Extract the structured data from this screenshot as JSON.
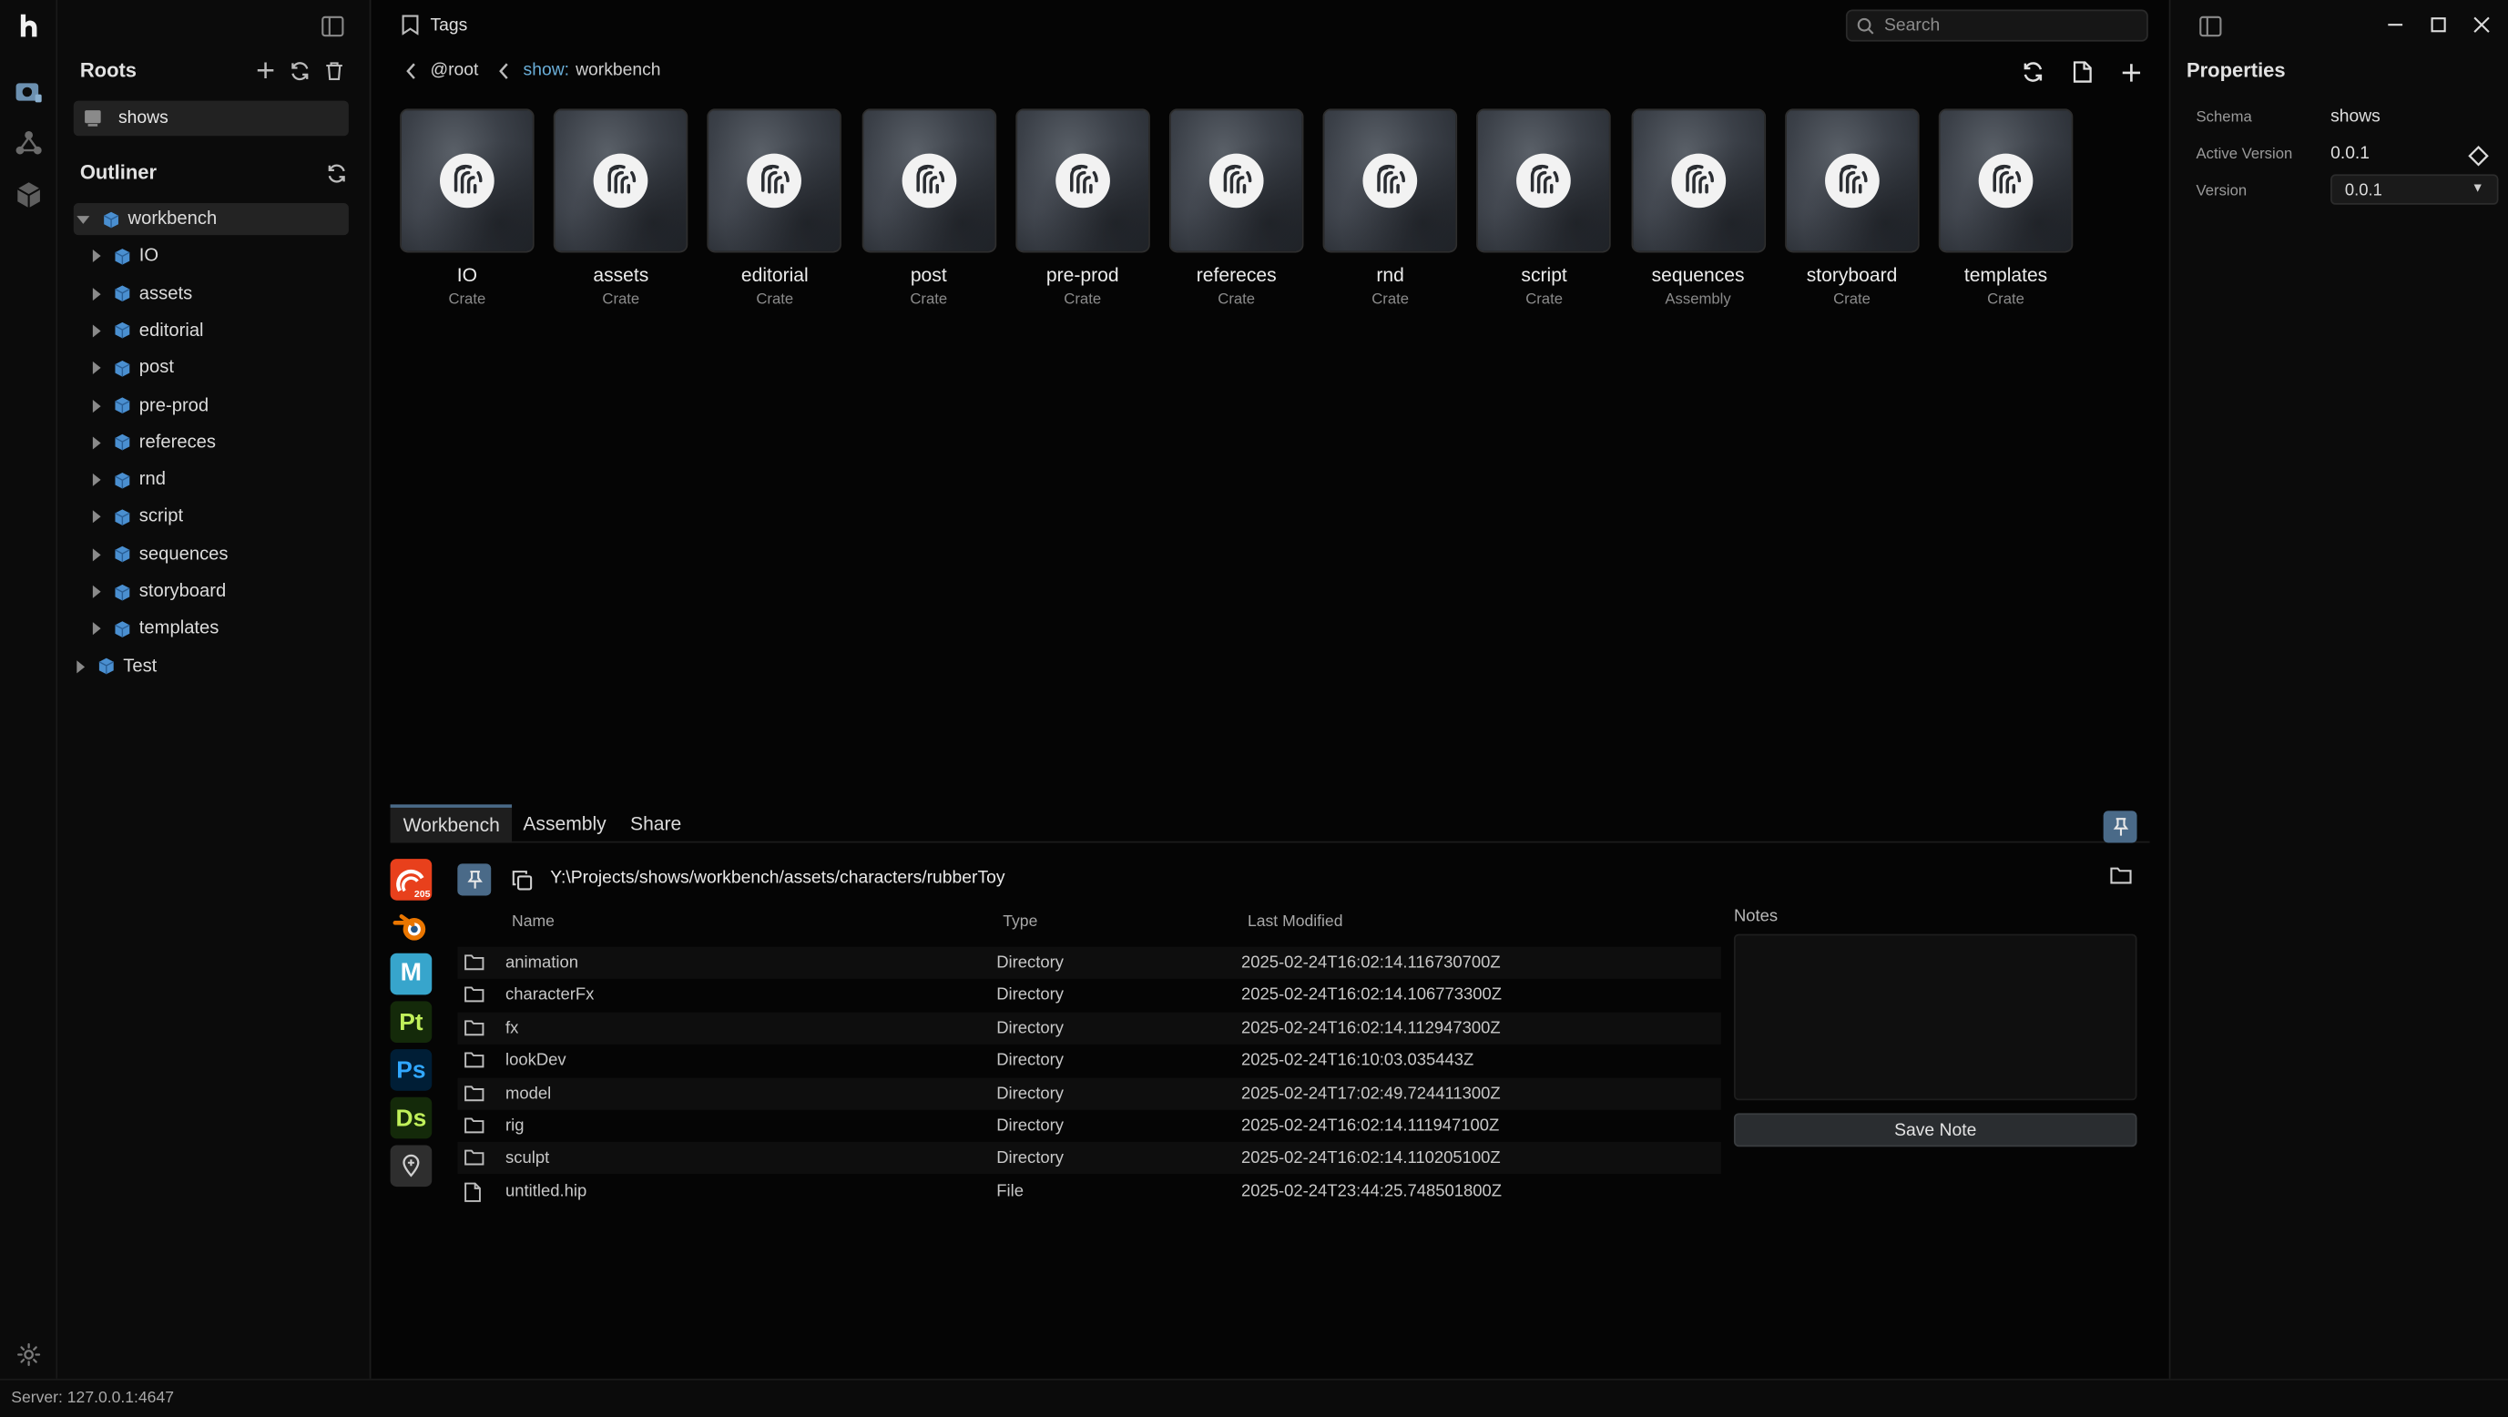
{
  "roots": {
    "title": "Roots",
    "items": [
      {
        "label": "shows"
      }
    ]
  },
  "outliner": {
    "title": "Outliner",
    "tree": [
      {
        "label": "workbench",
        "expanded": true,
        "selected": true,
        "children": [
          {
            "label": "IO"
          },
          {
            "label": "assets"
          },
          {
            "label": "editorial"
          },
          {
            "label": "post"
          },
          {
            "label": "pre-prod"
          },
          {
            "label": "refereces"
          },
          {
            "label": "rnd"
          },
          {
            "label": "script"
          },
          {
            "label": "sequences"
          },
          {
            "label": "storyboard"
          },
          {
            "label": "templates"
          }
        ]
      },
      {
        "label": "Test",
        "expanded": false
      }
    ]
  },
  "header": {
    "tags_label": "Tags",
    "search_placeholder": "Search"
  },
  "breadcrumb": {
    "root": "@root",
    "key": "show:",
    "value": "workbench"
  },
  "tiles": [
    {
      "name": "IO",
      "type": "Crate"
    },
    {
      "name": "assets",
      "type": "Crate"
    },
    {
      "name": "editorial",
      "type": "Crate"
    },
    {
      "name": "post",
      "type": "Crate"
    },
    {
      "name": "pre-prod",
      "type": "Crate"
    },
    {
      "name": "refereces",
      "type": "Crate"
    },
    {
      "name": "rnd",
      "type": "Crate"
    },
    {
      "name": "script",
      "type": "Crate"
    },
    {
      "name": "sequences",
      "type": "Assembly"
    },
    {
      "name": "storyboard",
      "type": "Crate"
    },
    {
      "name": "templates",
      "type": "Crate"
    }
  ],
  "properties": {
    "title": "Properties",
    "schema_label": "Schema",
    "schema_value": "shows",
    "active_version_label": "Active Version",
    "active_version_value": "0.0.1",
    "version_label": "Version",
    "version_value": "0.0.1"
  },
  "bottom": {
    "tabs": [
      {
        "label": "Workbench",
        "active": true
      },
      {
        "label": "Assembly"
      },
      {
        "label": "Share"
      }
    ],
    "path": "Y:\\Projects/shows/workbench/assets/characters/rubberToy",
    "columns": {
      "name": "Name",
      "type": "Type",
      "modified": "Last Modified"
    },
    "files": [
      {
        "name": "animation",
        "type": "Directory",
        "modified": "2025-02-24T16:02:14.116730700Z",
        "kind": "folder"
      },
      {
        "name": "characterFx",
        "type": "Directory",
        "modified": "2025-02-24T16:02:14.106773300Z",
        "kind": "folder"
      },
      {
        "name": "fx",
        "type": "Directory",
        "modified": "2025-02-24T16:02:14.112947300Z",
        "kind": "folder"
      },
      {
        "name": "lookDev",
        "type": "Directory",
        "modified": "2025-02-24T16:10:03.035443Z",
        "kind": "folder"
      },
      {
        "name": "model",
        "type": "Directory",
        "modified": "2025-02-24T17:02:49.724411300Z",
        "kind": "folder"
      },
      {
        "name": "rig",
        "type": "Directory",
        "modified": "2025-02-24T16:02:14.111947100Z",
        "kind": "folder"
      },
      {
        "name": "sculpt",
        "type": "Directory",
        "modified": "2025-02-24T16:02:14.110205100Z",
        "kind": "folder"
      },
      {
        "name": "untitled.hip",
        "type": "File",
        "modified": "2025-02-24T23:44:25.748501800Z",
        "kind": "file"
      }
    ],
    "notes_label": "Notes",
    "save_note_label": "Save Note",
    "apps": [
      {
        "name": "houdini-icon",
        "text": "205",
        "color": "#ff4713"
      },
      {
        "name": "blender-icon",
        "text": "",
        "color": "#ea7600"
      },
      {
        "name": "maya-icon",
        "text": "M",
        "color": "#37a5cc"
      },
      {
        "name": "substance-painter-icon",
        "text": "Pt",
        "color": "#c0f05a"
      },
      {
        "name": "photoshop-icon",
        "text": "Ps",
        "color": "#31a8ff"
      },
      {
        "name": "substance-designer-icon",
        "text": "Ds",
        "color": "#c0f05a"
      },
      {
        "name": "add-app-icon",
        "text": "",
        "color": "#9a9a9a"
      }
    ]
  },
  "status": {
    "server": "Server: 127.0.0.1:4647"
  },
  "colors": {
    "accent": "#4a6a88",
    "breadcrumb_key": "#6aaed8",
    "cube": "#4a8fd0"
  }
}
